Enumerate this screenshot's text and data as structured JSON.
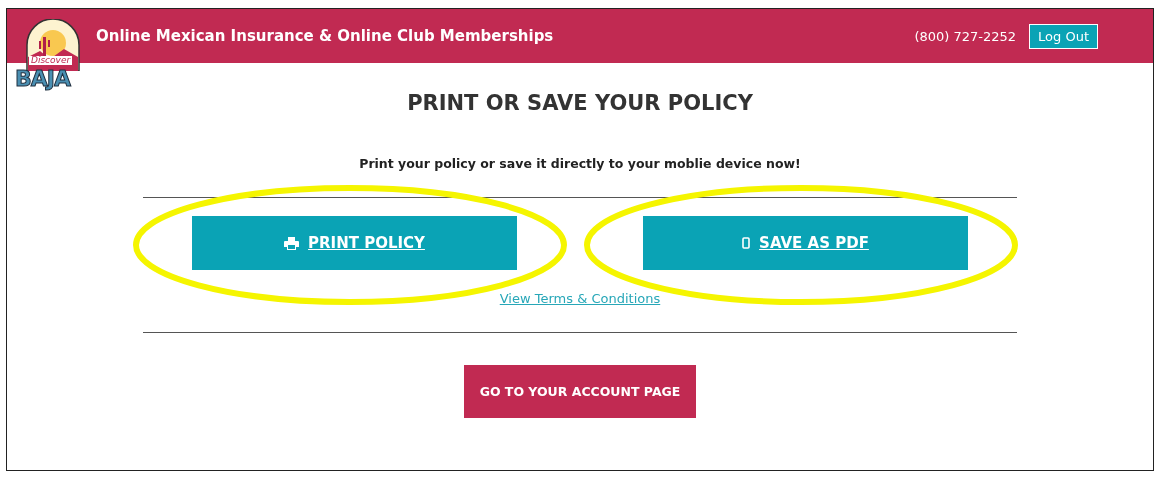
{
  "header": {
    "logo": {
      "script": "Discover",
      "word": "BAJA"
    },
    "title": "Online Mexican Insurance & Online Club Memberships",
    "phone": "(800) 727-2252",
    "logout": "Log Out"
  },
  "page": {
    "heading": "PRINT OR SAVE YOUR POLICY",
    "subtitle": "Print your policy or save it directly to your moblie device now!",
    "actions": [
      {
        "kind": "print",
        "label": "PRINT POLICY",
        "highlighted": true
      },
      {
        "kind": "pdf",
        "label": "SAVE AS PDF",
        "highlighted": true
      }
    ],
    "terms_link": "View Terms & Conditions",
    "account_button": "GO TO YOUR ACCOUNT PAGE"
  }
}
